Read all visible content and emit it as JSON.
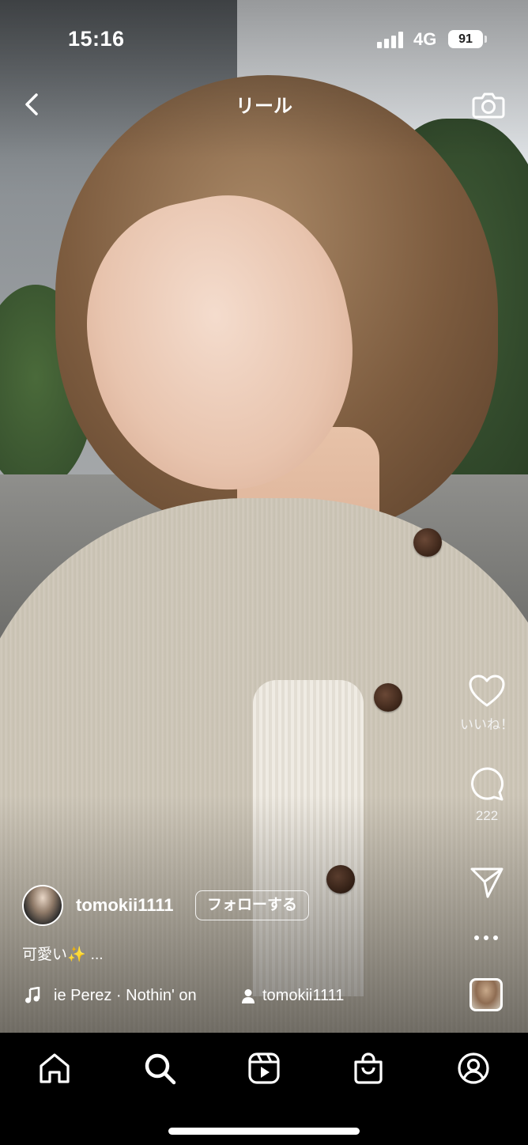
{
  "status_bar": {
    "time": "15:16",
    "network": "4G",
    "battery": "91"
  },
  "header": {
    "title": "リール",
    "back_icon": "chevron-left-icon",
    "camera_icon": "camera-icon"
  },
  "actions": {
    "like_count": "いいね！",
    "comment_count": "222",
    "like_icon": "heart-icon",
    "comment_icon": "comment-bubble-icon",
    "share_icon": "paper-plane-icon",
    "more_icon": "more-dots-icon"
  },
  "author": {
    "username": "tomokii1111",
    "follow_label": "フォローする"
  },
  "caption": {
    "text": "可愛い✨",
    "more": "..."
  },
  "audio": {
    "track": "ie Perez · Nothin' on",
    "original_user": "tomokii1111"
  },
  "tabbar": {
    "items": [
      "home-icon",
      "search-icon",
      "reels-icon",
      "shop-icon",
      "profile-icon"
    ],
    "active": "search-icon"
  },
  "colors": {
    "text": "#ffffff",
    "tabbar_bg": "#000000"
  }
}
